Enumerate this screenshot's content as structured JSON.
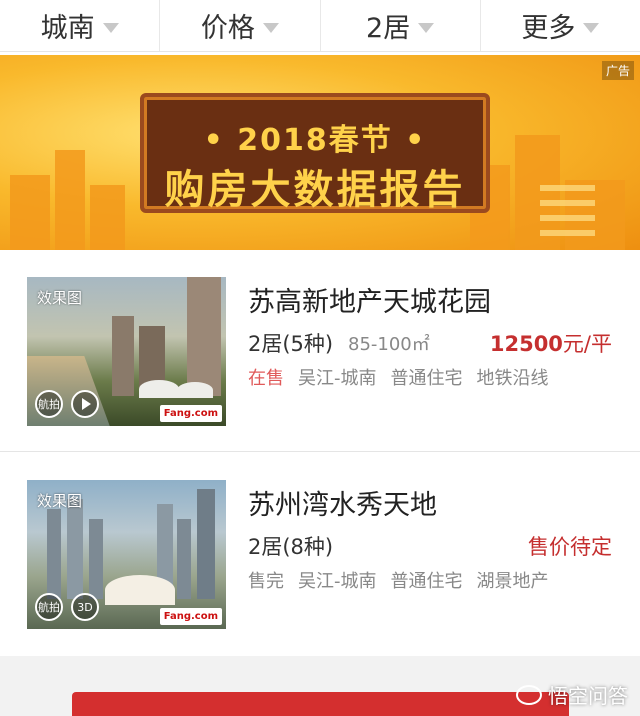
{
  "filters": [
    {
      "label": "城南"
    },
    {
      "label": "价格"
    },
    {
      "label": "2居"
    },
    {
      "label": "更多"
    }
  ],
  "banner": {
    "ad_label": "广告",
    "line1": "• 2018春节 •",
    "line2": "购房大数据报告"
  },
  "listings": [
    {
      "image_tag": "效果图",
      "ctrl1": "航拍",
      "name": "苏高新地产天城花园",
      "layout": "2居(5种)",
      "area": "85-100㎡",
      "price_value": "12500",
      "price_unit": "元/平",
      "status": "在售",
      "tags": [
        "吴江-城南",
        "普通住宅",
        "地铁沿线"
      ],
      "logo": "Fang.com"
    },
    {
      "image_tag": "效果图",
      "ctrl1": "航拍",
      "ctrl2": "3D",
      "name": "苏州湾水秀天地",
      "layout": "2居(8种)",
      "price_text": "售价待定",
      "status": "售完",
      "tags": [
        "吴江-城南",
        "普通住宅",
        "湖景地产"
      ],
      "logo": "Fang.com"
    }
  ],
  "watermark": "悟空问答"
}
